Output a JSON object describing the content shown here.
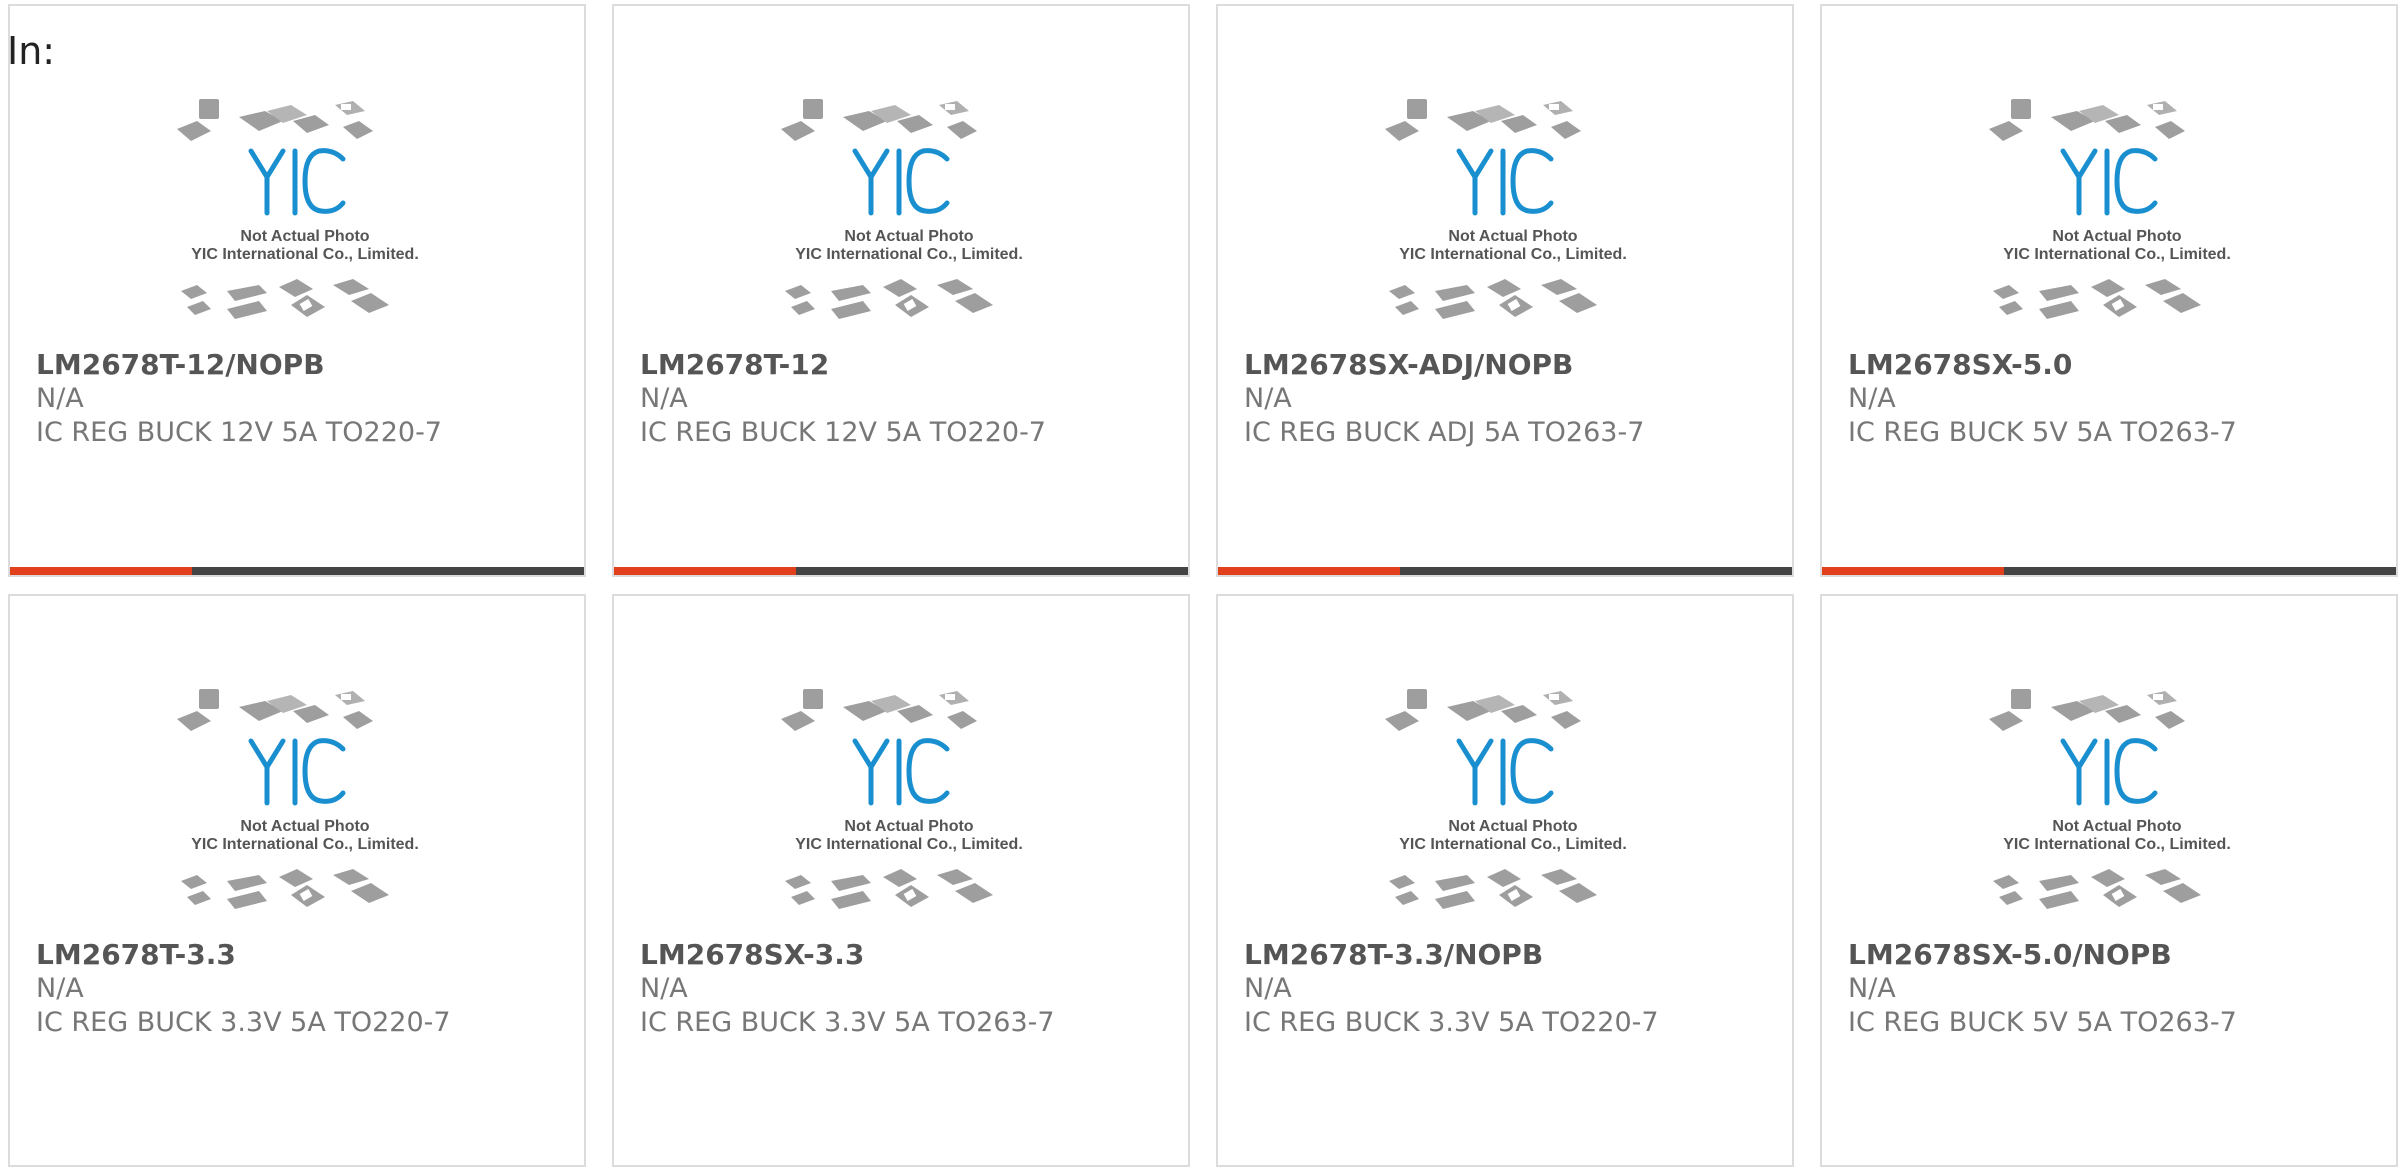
{
  "page": {
    "label": "In:"
  },
  "placeholder": {
    "logo_text": "YIC",
    "line1": "Not Actual Photo",
    "line2": "YIC International Co., Limited."
  },
  "colors": {
    "accent": "#e2401c",
    "bar_dark": "#444444",
    "logo_blue": "#1a8fd0",
    "chip_gray": "#9e9e9e"
  },
  "products": [
    {
      "part": "LM2678T-12/NOPB",
      "mfr": "N/A",
      "desc": "IC REG BUCK 12V 5A TO220-7"
    },
    {
      "part": "LM2678T-12",
      "mfr": "N/A",
      "desc": "IC REG BUCK 12V 5A TO220-7"
    },
    {
      "part": "LM2678SX-ADJ/NOPB",
      "mfr": "N/A",
      "desc": "IC REG BUCK ADJ 5A TO263-7"
    },
    {
      "part": "LM2678SX-5.0",
      "mfr": "N/A",
      "desc": "IC REG BUCK 5V 5A TO263-7"
    },
    {
      "part": "LM2678T-3.3",
      "mfr": "N/A",
      "desc": "IC REG BUCK 3.3V 5A TO220-7"
    },
    {
      "part": "LM2678SX-3.3",
      "mfr": "N/A",
      "desc": "IC REG BUCK 3.3V 5A TO263-7"
    },
    {
      "part": "LM2678T-3.3/NOPB",
      "mfr": "N/A",
      "desc": "IC REG BUCK 3.3V 5A TO220-7"
    },
    {
      "part": "LM2678SX-5.0/NOPB",
      "mfr": "N/A",
      "desc": "IC REG BUCK 5V 5A TO263-7"
    }
  ]
}
